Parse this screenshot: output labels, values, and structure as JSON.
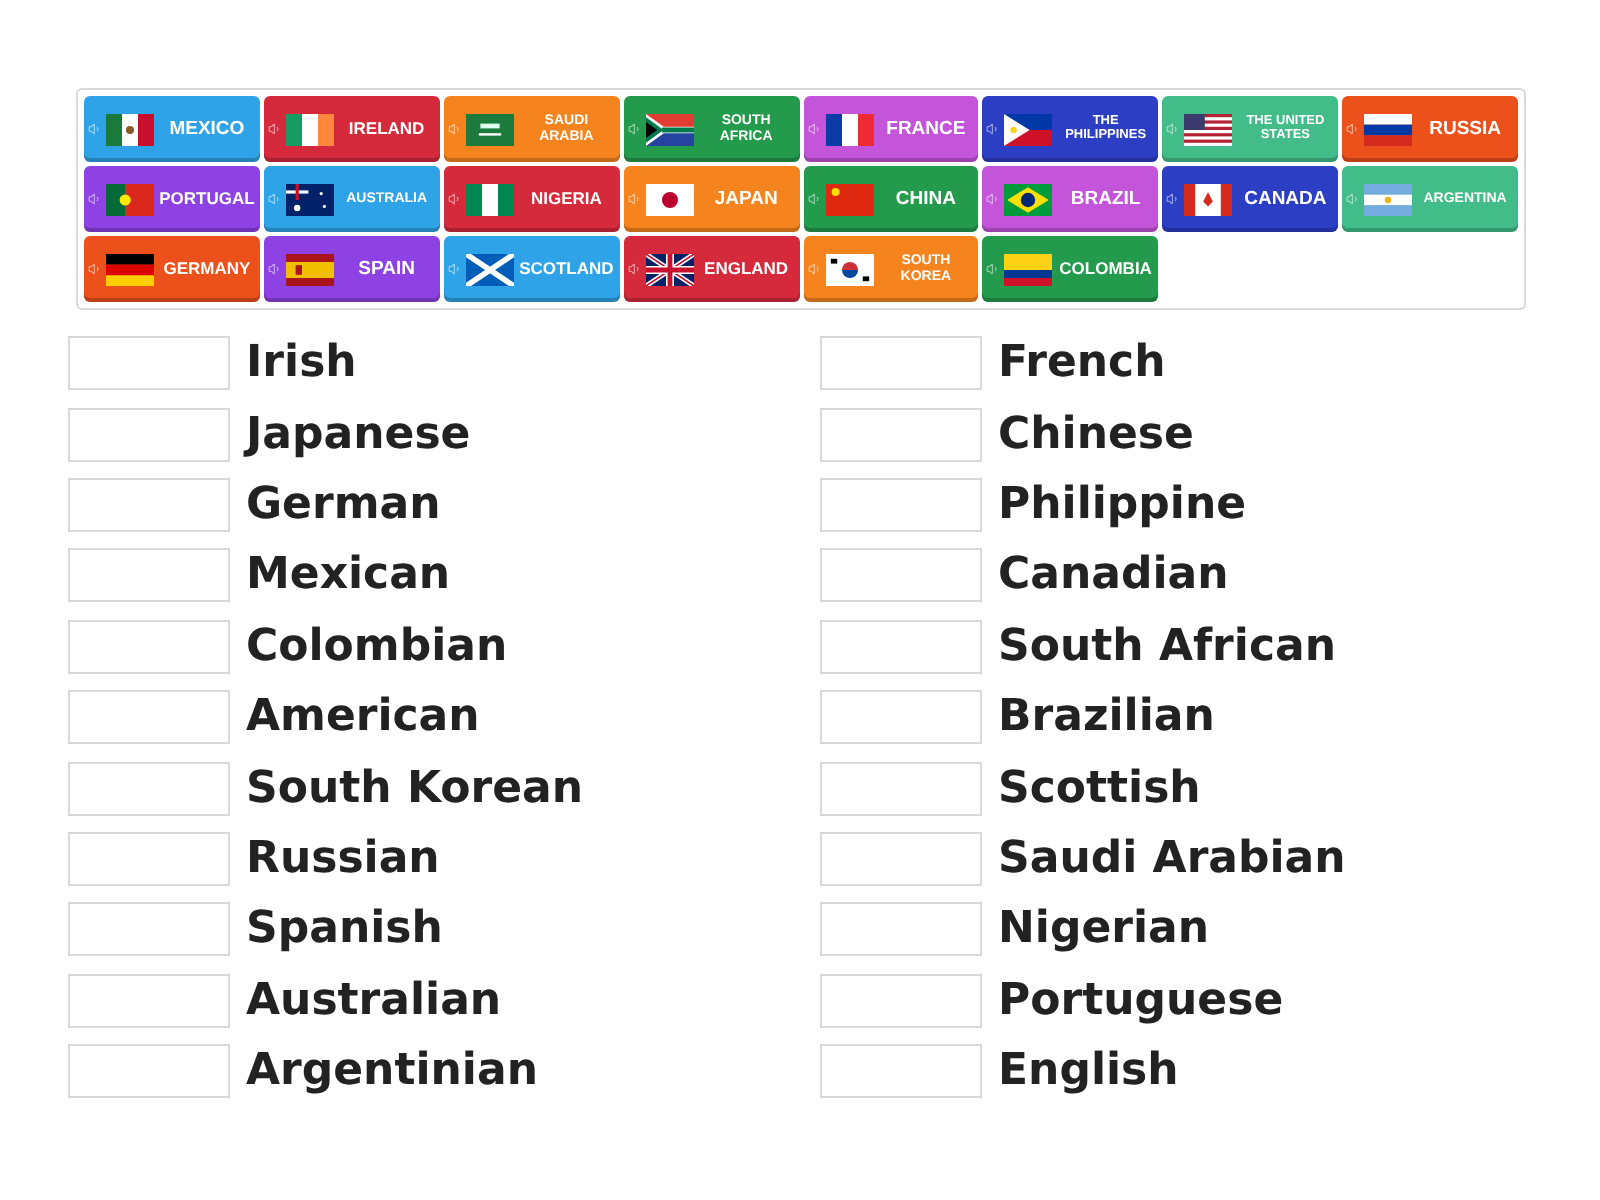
{
  "tiles": [
    {
      "label": "MEXICO",
      "color": "#2ea3e8"
    },
    {
      "label": "IRELAND",
      "color": "#d42a3c"
    },
    {
      "label": "SAUDI ARABIA",
      "color": "#f5841f"
    },
    {
      "label": "SOUTH AFRICA",
      "color": "#239a4c"
    },
    {
      "label": "FRANCE",
      "color": "#c454da"
    },
    {
      "label": "THE PHILIPPINES",
      "color": "#2b3ec4"
    },
    {
      "label": "THE UNITED STATES",
      "color": "#42bd8a"
    },
    {
      "label": "RUSSIA",
      "color": "#ec511c"
    },
    {
      "label": "PORTUGAL",
      "color": "#8f42e4"
    },
    {
      "label": "AUSTRALIA",
      "color": "#2ea3e8"
    },
    {
      "label": "NIGERIA",
      "color": "#d42a3c"
    },
    {
      "label": "JAPAN",
      "color": "#f5841f"
    },
    {
      "label": "CHINA",
      "color": "#239a4c"
    },
    {
      "label": "BRAZIL",
      "color": "#c454da"
    },
    {
      "label": "CANADA",
      "color": "#2b3ec4"
    },
    {
      "label": "ARGENTINA",
      "color": "#42bd8a"
    },
    {
      "label": "GERMANY",
      "color": "#ec511c"
    },
    {
      "label": "SPAIN",
      "color": "#8f42e4"
    },
    {
      "label": "SCOTLAND",
      "color": "#2ea3e8"
    },
    {
      "label": "ENGLAND",
      "color": "#d42a3c"
    },
    {
      "label": "SOUTH KOREA",
      "color": "#f5841f"
    },
    {
      "label": "COLOMBIA",
      "color": "#239a4c"
    }
  ],
  "left_items": [
    "Irish",
    "Japanese",
    "German",
    "Mexican",
    "Colombian",
    "American",
    "South Korean",
    "Russian",
    "Spanish",
    "Australian",
    "Argentinian"
  ],
  "right_items": [
    "French",
    "Chinese",
    "Philippine",
    "Canadian",
    "South African",
    "Brazilian",
    "Scottish",
    "Saudi Arabian",
    "Nigerian",
    "Portuguese",
    "English"
  ]
}
